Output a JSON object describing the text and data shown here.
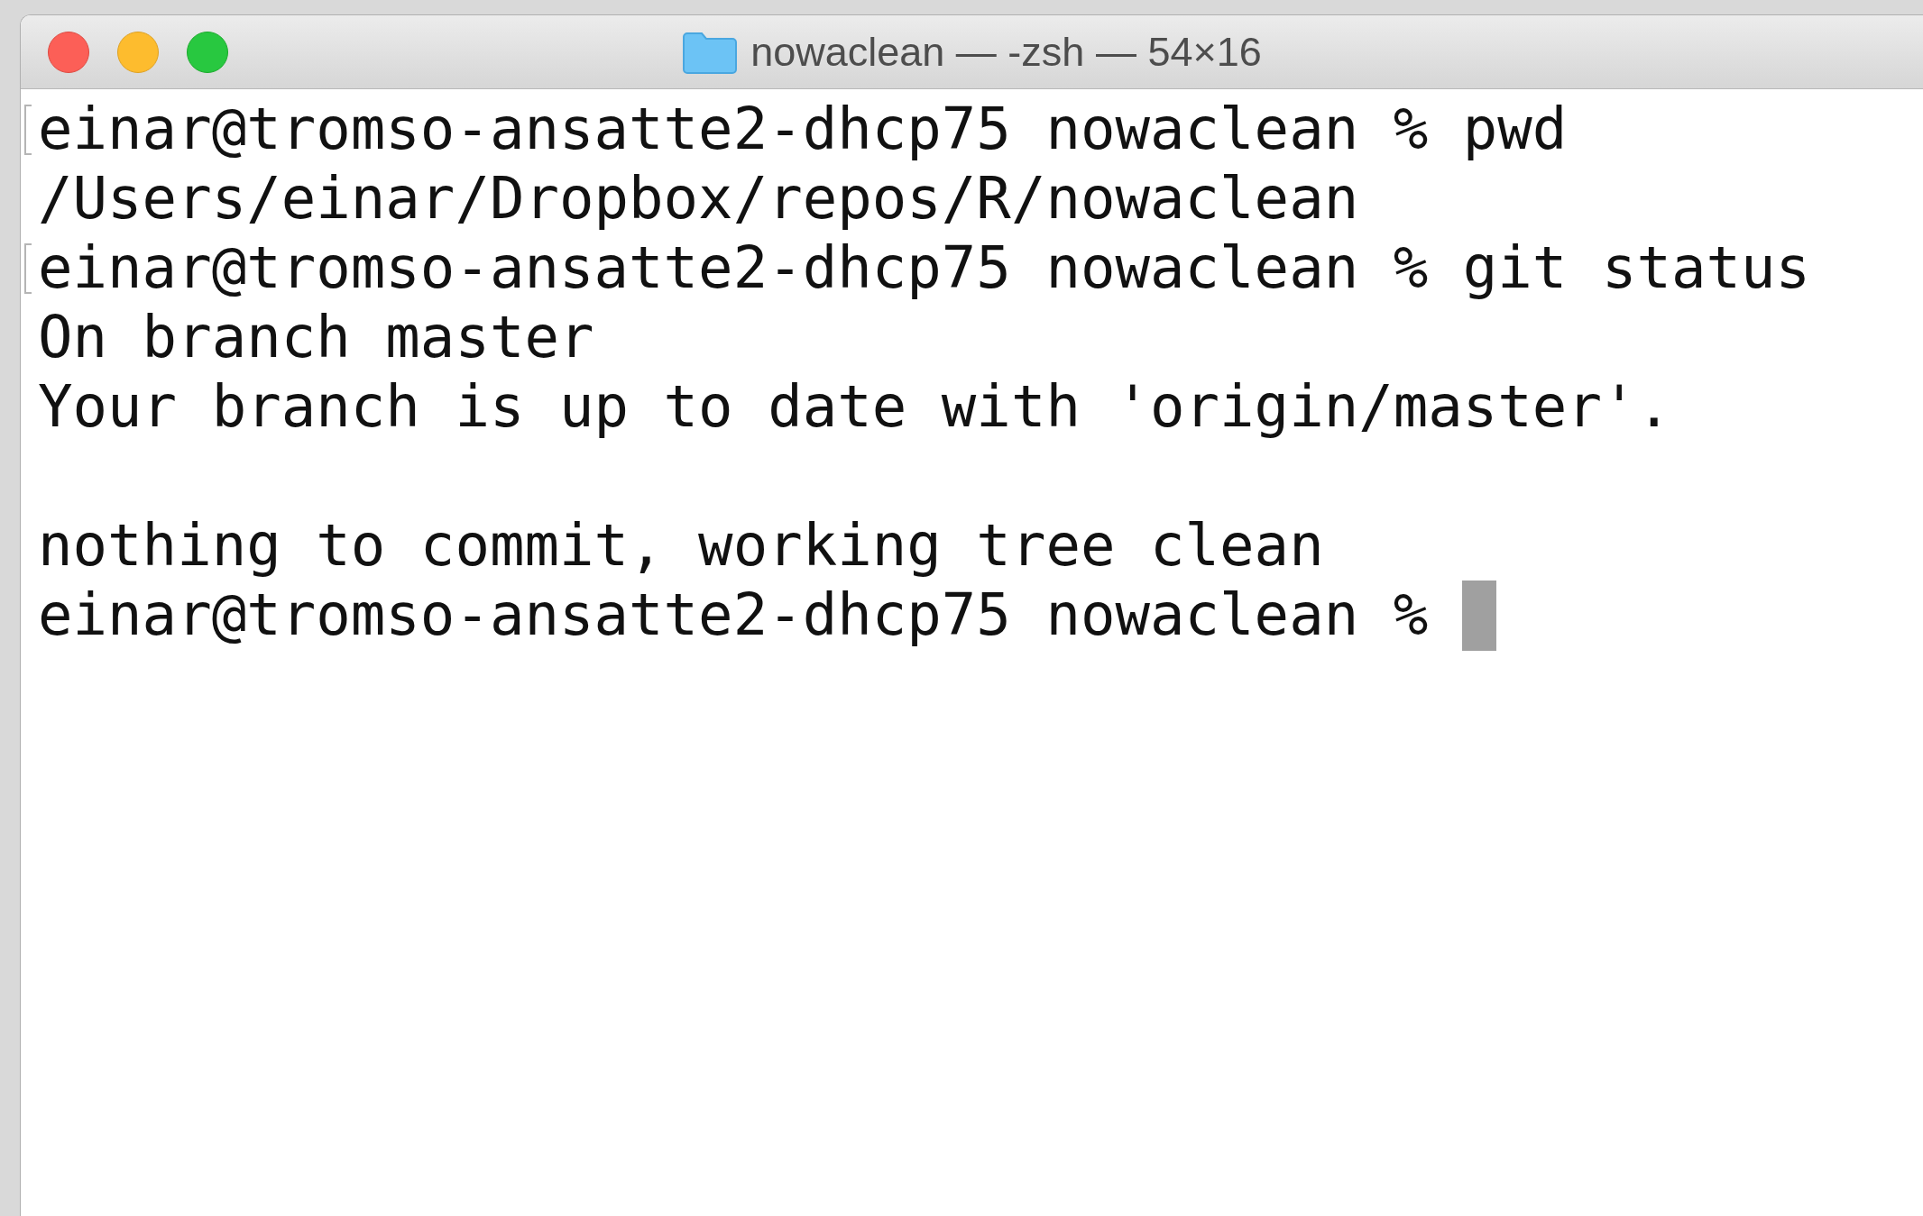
{
  "window": {
    "title": "nowaclean — -zsh — 54×16"
  },
  "lines": [
    {
      "kind": "text",
      "text": "einar@tromso-ansatte2-dhcp75 nowaclean % pwd",
      "marked": true,
      "cursor": false
    },
    {
      "kind": "text",
      "text": "/Users/einar/Dropbox/repos/R/nowaclean",
      "marked": false,
      "cursor": false
    },
    {
      "kind": "text",
      "text": "einar@tromso-ansatte2-dhcp75 nowaclean % git status",
      "marked": true,
      "cursor": false
    },
    {
      "kind": "text",
      "text": "On branch master",
      "marked": false,
      "cursor": false
    },
    {
      "kind": "text",
      "text": "Your branch is up to date with 'origin/master'.",
      "marked": false,
      "cursor": false
    },
    {
      "kind": "blank"
    },
    {
      "kind": "text",
      "text": "nothing to commit, working tree clean",
      "marked": false,
      "cursor": false
    },
    {
      "kind": "text",
      "text": "einar@tromso-ansatte2-dhcp75 nowaclean %",
      "marked": false,
      "cursor": true
    }
  ]
}
